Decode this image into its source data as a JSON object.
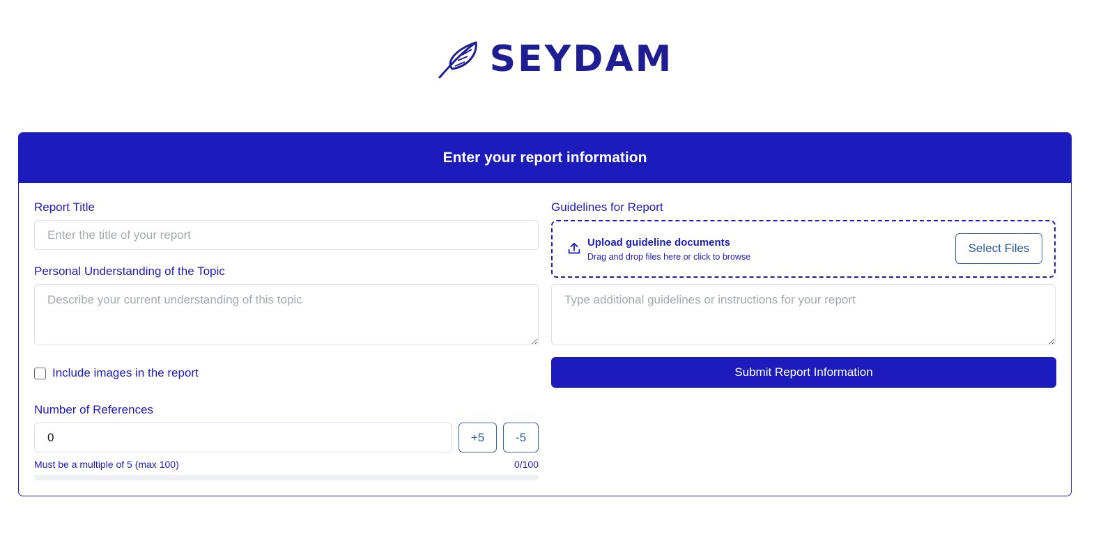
{
  "brand": {
    "name": "SEYDAM",
    "icon": "feather-icon",
    "color": "#1e1e92"
  },
  "colors": {
    "primary": "#1c1cbd",
    "field_border": "#dcdfe8",
    "placeholder": "#a4a8b4"
  },
  "form": {
    "header": "Enter your report information",
    "report_title": {
      "label": "Report Title",
      "placeholder": "Enter the title of your report",
      "value": ""
    },
    "understanding": {
      "label": "Personal Understanding of the Topic",
      "placeholder": "Describe your current understanding of this topic",
      "value": ""
    },
    "include_images": {
      "label": "Include images in the report",
      "checked": false
    },
    "references": {
      "label": "Number of References",
      "value": "0",
      "plus_label": "+5",
      "minus_label": "-5",
      "hint": "Must be a multiple of 5 (max 100)",
      "count": "0/100",
      "progress_fraction": 0
    },
    "guidelines": {
      "label": "Guidelines for Report",
      "upload_icon": "upload-icon",
      "upload_title": "Upload guideline documents",
      "upload_sub": "Drag and drop files here or click to browse",
      "select_files": "Select Files",
      "instructions_placeholder": "Type additional guidelines or instructions for your report",
      "instructions_value": ""
    },
    "submit_label": "Submit Report Information"
  }
}
